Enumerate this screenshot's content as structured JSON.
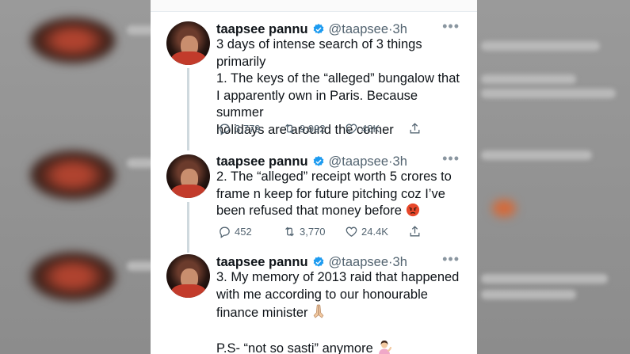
{
  "tweets": [
    {
      "name": "taapsee pannu",
      "handle": "@taapsee",
      "time": "3h",
      "more": "•••",
      "line1": "3 days of intense search of 3 things",
      "line2": "primarily",
      "line3": "1. The keys of the “alleged” bungalow that",
      "line4": "I apparently own in Paris. Because summer",
      "line5": "holidays are around the corner",
      "replies": "3,779",
      "retweets": "9,992",
      "likes": "48K"
    },
    {
      "name": "taapsee pannu",
      "handle": "@taapsee",
      "time": "3h",
      "more": "•••",
      "line1": "2. The “alleged” receipt worth 5 crores to",
      "line2": "frame n keep for future pitching coz I’ve",
      "line3": "been refused that money before",
      "replies": "452",
      "retweets": "3,770",
      "likes": "24.4K"
    },
    {
      "name": "taapsee pannu",
      "handle": "@taapsee",
      "time": "3h",
      "more": "•••",
      "line1": "3. My memory of 2013 raid that happened",
      "line2": "with me according to our honourable",
      "line3": "finance minister",
      "line4": "P.S- “not so sasti” anymore"
    }
  ],
  "icons": {
    "verified": "verified-badge-icon",
    "reply": "reply-icon",
    "retweet": "retweet-icon",
    "like": "heart-icon",
    "share": "share-icon",
    "angry": "angry-face-emoji",
    "pray": "folded-hands-emoji",
    "tip": "person-tipping-hand-emoji"
  },
  "colors": {
    "verified": "#1d9bf0",
    "text": "#0f1419",
    "muted": "#536471"
  }
}
